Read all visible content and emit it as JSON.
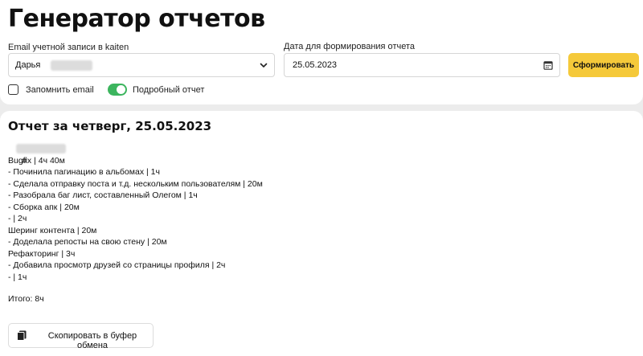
{
  "page": {
    "title": "Генератор отчетов"
  },
  "form": {
    "email_label": "Email учетной записи в kaiten",
    "email_value": "Дарья",
    "date_label": "Дата для формирования отчета",
    "date_value": "25.05.2023",
    "submit_label": "Сформировать",
    "remember_email_label": "Запомнить email",
    "remember_email_checked": false,
    "detailed_report_label": "Подробный отчет",
    "detailed_report_on": true
  },
  "report": {
    "title": "Отчет за четверг, 25.05.2023",
    "hash_prefix": "#",
    "lines": [
      "Bugfix | 4ч 40м",
      "- Починила пагинацию в альбомах | 1ч",
      "- Сделала отправку поста и т.д. нескольким пользователям | 20м",
      "- Разобрала баг лист, составленный Олегом | 1ч",
      "- Сборка апк | 20м",
      "- | 2ч",
      "Шеринг контента | 20м",
      "- Доделала репосты на свою стену | 20м",
      "Рефакторинг | 3ч",
      "- Добавила просмотр друзей со страницы профиля | 2ч",
      "- | 1ч"
    ],
    "total": "Итого: 8ч",
    "copy_label": "Скопировать в буфер обмена"
  },
  "colors": {
    "accent_button": "#f5c93a",
    "toggle_on": "#3cb55e",
    "background": "#ececec"
  },
  "icons": {
    "select": "chevron-down-icon",
    "date": "calendar-icon",
    "copy": "copy-icon"
  }
}
